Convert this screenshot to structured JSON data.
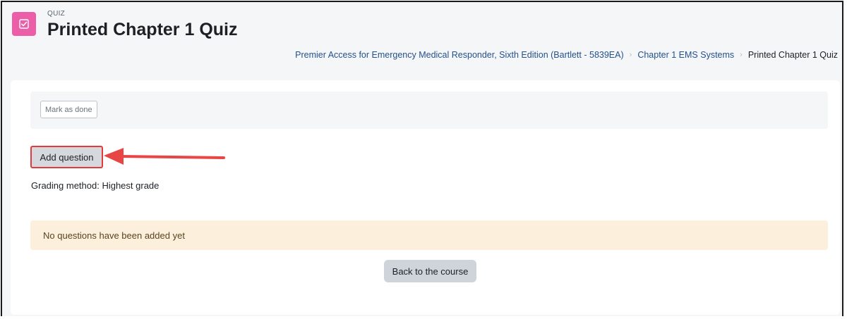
{
  "header": {
    "module_type": "QUIZ",
    "title": "Printed Chapter 1 Quiz",
    "icon": "quiz-checkbox-icon",
    "icon_color": "#ec5fa8"
  },
  "breadcrumb": {
    "items": [
      "Premier Access for Emergency Medical Responder, Sixth Edition (Bartlett - 5839EA)",
      "Chapter 1 EMS Systems",
      "Printed Chapter 1 Quiz"
    ],
    "separator": "›"
  },
  "completion": {
    "mark_done_label": "Mark as done"
  },
  "actions": {
    "add_question_label": "Add question",
    "highlight_color": "#e23b3b"
  },
  "grading_method": "Grading method: Highest grade",
  "notice": {
    "text": "No questions have been added yet"
  },
  "footer": {
    "back_label": "Back to the course"
  }
}
